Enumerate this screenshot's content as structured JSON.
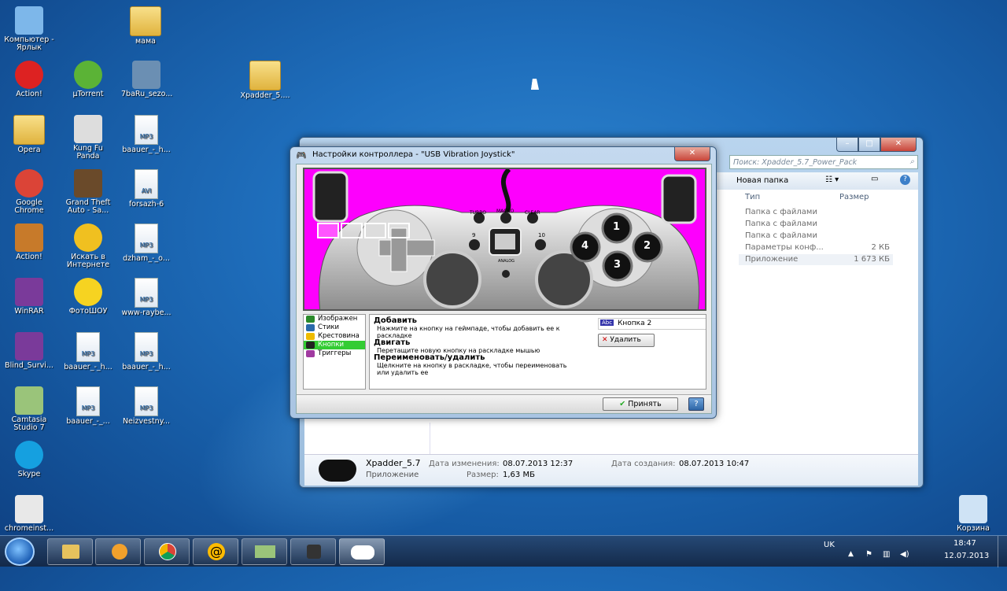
{
  "desktop": {
    "icons": [
      {
        "label": "Компьютер - Ярлык"
      },
      {
        "label": "мама"
      },
      {
        "label": "Action!"
      },
      {
        "label": "µTorrent"
      },
      {
        "label": "7baRu_sezo..."
      },
      {
        "label": "Xpadder_5...."
      },
      {
        "label": "Opera"
      },
      {
        "label": "Kung Fu Panda"
      },
      {
        "label": "baauer_-_h..."
      },
      {
        "label": "Google Chrome"
      },
      {
        "label": "Grand Theft Auto - Sa..."
      },
      {
        "label": "forsazh-6"
      },
      {
        "label": "Action!"
      },
      {
        "label": "Искать в Интернете"
      },
      {
        "label": "dzham_-_o..."
      },
      {
        "label": "WinRAR"
      },
      {
        "label": "ФотоШОУ"
      },
      {
        "label": "www-raybe..."
      },
      {
        "label": "Blind_Survi..."
      },
      {
        "label": "baauer_-_h..."
      },
      {
        "label": "baauer_-_h..."
      },
      {
        "label": "Camtasia Studio 7"
      },
      {
        "label": "baauer_-_..."
      },
      {
        "label": "Neizvestny..."
      },
      {
        "label": "Skype"
      },
      {
        "label": "chromeinst..."
      },
      {
        "label": "Корзина"
      }
    ],
    "mp3_tag": "MP3",
    "avi_tag": "AVI"
  },
  "explorer": {
    "search_placeholder": "Поиск: Xpadder_5.7_Power_Pack",
    "new_folder": "Новая папка",
    "col_type": "Тип",
    "col_size": "Размер",
    "rows": [
      {
        "type": "Папка с файлами",
        "size": ""
      },
      {
        "type": "Папка с файлами",
        "size": ""
      },
      {
        "type": "Папка с файлами",
        "size": ""
      },
      {
        "type": "Параметры конф...",
        "size": "2 КБ"
      },
      {
        "type": "Приложение",
        "size": "1 673 КБ"
      }
    ],
    "details": {
      "name": "Xpadder_5.7",
      "type": "Приложение",
      "modified_label": "Дата изменения:",
      "modified": "08.07.2013 12:37",
      "size_label": "Размер:",
      "size": "1,63 МБ",
      "created_label": "Дата создания:",
      "created": "08.07.2013 10:47"
    }
  },
  "dialog": {
    "title": "Настройки контроллера - \"USB Vibration Joystick\"",
    "pad_labels": {
      "turbo": "TURBO",
      "macro": "MACRO",
      "clear": "CLEAR",
      "nine": "9",
      "ten": "10",
      "analog": "ANALOG",
      "b1": "1",
      "b2": "2",
      "b3": "3",
      "b4": "4"
    },
    "menu": [
      "Изображен",
      "Стики",
      "Крестовина",
      "Кнопки",
      "Триггеры"
    ],
    "help": [
      {
        "h": "Добавить",
        "t": "Нажмите на кнопку на геймпаде, чтобы добавить ее к раскладке"
      },
      {
        "h": "Двигать",
        "t": "Перетащите новую кнопку на раскладке мышью"
      },
      {
        "h": "Переименовать/удалить",
        "t": "Щелкните на кнопку в раскладке, чтобы переименовать или удалить ее"
      }
    ],
    "name_value": "Кнопка 2",
    "delete": "Удалить",
    "accept": "Принять",
    "help_btn": "?"
  },
  "taskbar": {
    "lang": "UK",
    "time": "18:47",
    "date": "12.07.2013"
  }
}
